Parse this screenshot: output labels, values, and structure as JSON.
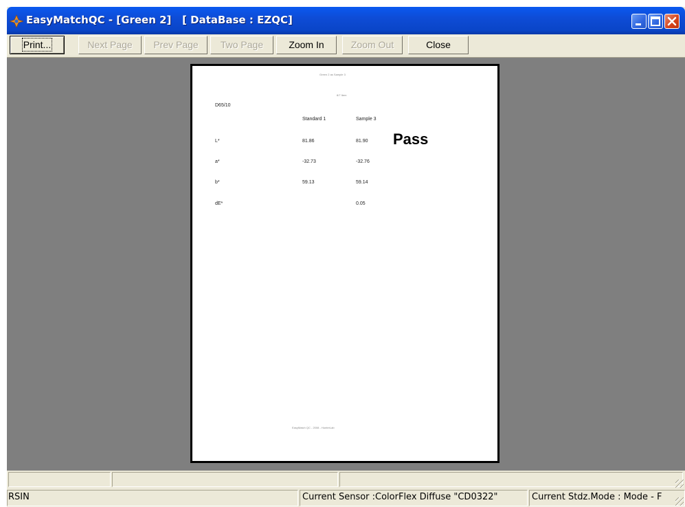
{
  "window": {
    "title": "EasyMatchQC - [Green 2]   [ DataBase : EZQC]",
    "titlebar_color": "#0A4FD8",
    "caption_buttons": [
      "minimize-icon",
      "maximize-icon",
      "close-icon"
    ]
  },
  "toolbar": {
    "buttons": [
      {
        "label": "Print...",
        "enabled": true,
        "focused": true
      },
      {
        "label": "Next Page",
        "enabled": false
      },
      {
        "label": "Prev Page",
        "enabled": false
      },
      {
        "label": "Two Page",
        "enabled": false
      },
      {
        "label": "Zoom In",
        "enabled": true
      },
      {
        "label": "Zoom Out",
        "enabled": false
      },
      {
        "label": "Close",
        "enabled": true
      }
    ]
  },
  "preview": {
    "background": "#7F7F7F",
    "page": {
      "header_line1": "Green 2 as Sample 3",
      "header_line2": "8/7 Item",
      "illuminant": "D65/10",
      "col_standard": "Standard 1",
      "col_sample": "Sample 3",
      "rows": [
        {
          "label": "L*",
          "standard": "81.86",
          "sample": "81.90"
        },
        {
          "label": "a*",
          "standard": "-32.73",
          "sample": "-32.76"
        },
        {
          "label": "b*",
          "standard": "59.13",
          "sample": "59.14"
        },
        {
          "label": "dE*",
          "standard": "",
          "sample": "0.05"
        }
      ],
      "result": "Pass",
      "footer": "EasyMatch QC - 2008 - HunterLab"
    }
  },
  "status": {
    "left": "RSIN",
    "sensor": "Current Sensor :ColorFlex Diffuse \"CD0322\"",
    "stdz_mode": "Current Stdz.Mode :  Mode - F"
  }
}
